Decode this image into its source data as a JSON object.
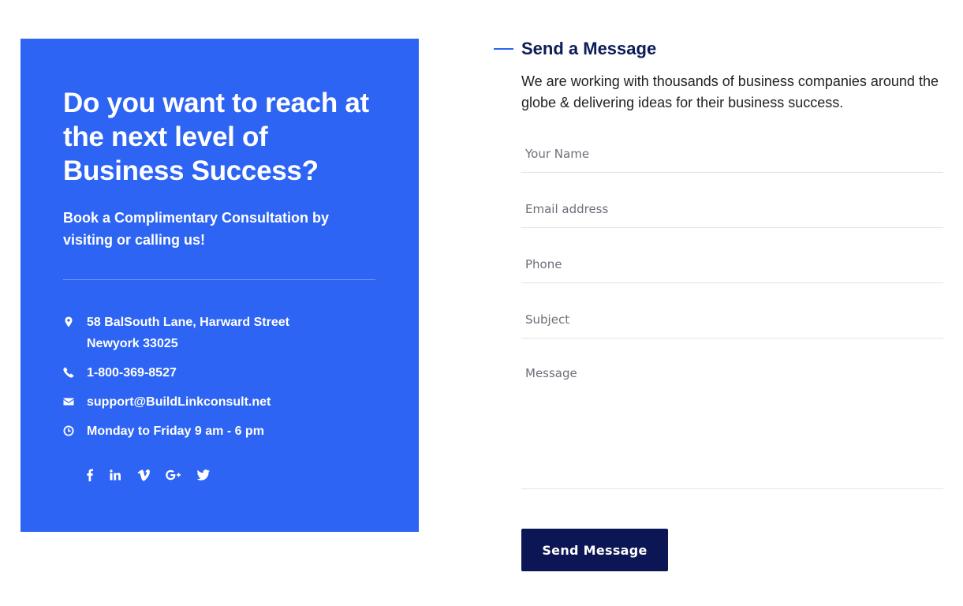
{
  "promo": {
    "title": "Do you want to reach at the next level of Business Success?",
    "subtitle": "Book a Complimentary Consultation by visiting or calling us!",
    "address_line1": "58 BalSouth Lane, Harward Street",
    "address_line2": "Newyork 33025",
    "phone": "1-800-369-8527",
    "email": "support@BuildLinkconsult.net",
    "hours": "Monday to Friday 9 am - 6 pm",
    "icons": [
      "map-pin-icon",
      "phone-icon",
      "envelope-icon",
      "clock-icon"
    ],
    "socials": [
      "facebook-icon",
      "linkedin-icon",
      "vimeo-icon",
      "google-plus-icon",
      "twitter-icon"
    ],
    "background_color": "#2d64f4"
  },
  "form": {
    "heading": "Send a Message",
    "intro": "We are working with thousands of business companies around the globe & delivering ideas for their business success.",
    "name_placeholder": "Your Name",
    "email_placeholder": "Email address",
    "phone_placeholder": "Phone",
    "subject_placeholder": "Subject",
    "message_placeholder": "Message",
    "submit_label": "Send Message",
    "accent_color": "#2d64f4",
    "button_color": "#0c1654"
  }
}
